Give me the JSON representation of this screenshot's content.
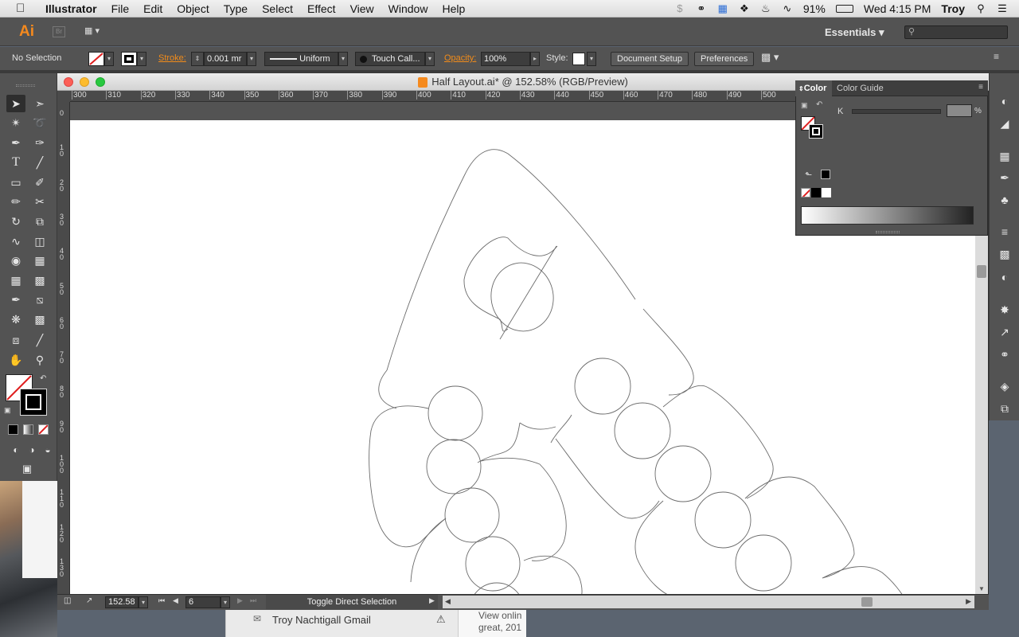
{
  "menubar": {
    "app_name": "Illustrator",
    "items": [
      "File",
      "Edit",
      "Object",
      "Type",
      "Select",
      "Effect",
      "View",
      "Window",
      "Help"
    ],
    "battery": "91%",
    "clock": "Wed 4:15 PM",
    "user": "Troy"
  },
  "appbar": {
    "logo": "Ai",
    "bridge": "Br",
    "workspace": "Essentials"
  },
  "control": {
    "selection": "No Selection",
    "stroke_label": "Stroke:",
    "stroke_value": "0.001 mr",
    "profile": "Uniform",
    "brush": "Touch Call...",
    "opacity_label": "Opacity:",
    "opacity_value": "100%",
    "style_label": "Style:",
    "doc_setup": "Document Setup",
    "preferences": "Preferences"
  },
  "document": {
    "title": "Half Layout.ai* @ 152.58% (RGB/Preview)",
    "ruler_h": [
      "300",
      "310",
      "320",
      "330",
      "340",
      "350",
      "360",
      "370",
      "380",
      "390",
      "400",
      "410",
      "420",
      "430",
      "440",
      "450",
      "460",
      "470",
      "480",
      "490",
      "500"
    ],
    "ruler_v": [
      "0",
      "10",
      "20",
      "30",
      "40",
      "50",
      "60",
      "70",
      "80",
      "90",
      "100",
      "110",
      "120",
      "130"
    ],
    "zoom": "152.58",
    "artboard_num": "6",
    "status_text": "Toggle Direct Selection"
  },
  "color_panel": {
    "tab_color": "Color",
    "tab_guide": "Color Guide",
    "channel": "K",
    "percent": "%"
  },
  "background": {
    "mail_account": "Troy Nachtigall Gmail",
    "mail_preview_1": "View onlin",
    "mail_preview_2": "great, 201"
  },
  "colors": {
    "accent": "#f28c1a",
    "panel": "#535353",
    "dark": "#3d3d3d"
  }
}
